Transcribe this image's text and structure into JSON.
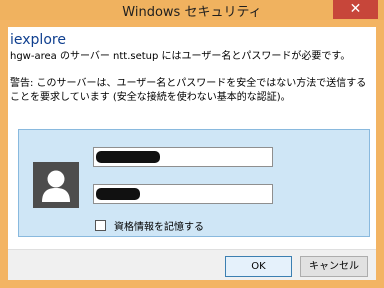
{
  "window": {
    "title": "Windows セキュリティ",
    "close_label": "✕"
  },
  "dialog": {
    "app_name": "iexplore",
    "description": "hgw-area のサーバー ntt.setup にはユーザー名とパスワードが必要です。",
    "warning": "警告: このサーバーは、ユーザー名とパスワードを安全ではない方法で送信することを要求しています (安全な接続を使わない基本的な認証)。"
  },
  "credentials": {
    "username_value": "",
    "password_value": "",
    "remember_label": "資格情報を記憶する",
    "remember_checked": false
  },
  "buttons": {
    "ok": "OK",
    "cancel": "キャンセル"
  },
  "colors": {
    "titlebar": "#f0b25f",
    "close_button": "#c7463a",
    "panel": "#cfe6f6",
    "app_name": "#0f3f8f"
  }
}
